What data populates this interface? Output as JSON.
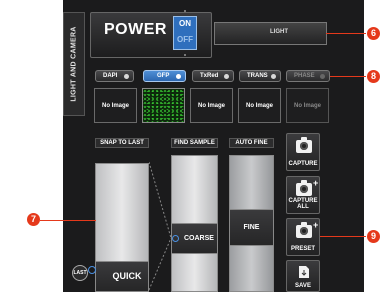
{
  "side_tab": "LIGHT AND CAMERA",
  "power": {
    "label": "POWER",
    "on": "ON",
    "off": "OFF"
  },
  "light": {
    "label": "LIGHT"
  },
  "channels": [
    {
      "label": "DAPI",
      "thumb": "No Image",
      "selected": false
    },
    {
      "label": "GFP",
      "thumb": "",
      "selected": true
    },
    {
      "label": "TxRed",
      "thumb": "No Image",
      "selected": false
    },
    {
      "label": "TRANS",
      "thumb": "No Image",
      "selected": false
    },
    {
      "label": "PHASE",
      "thumb": "No Image",
      "selected": false,
      "dimmed": true
    }
  ],
  "columns": {
    "snap_to_last": "SNAP TO LAST",
    "find_sample": "FIND SAMPLE",
    "auto_fine": "AUTO FINE"
  },
  "knobs": {
    "quick": "QUICK",
    "coarse": "COARSE",
    "fine": "FINE",
    "last": "LAST"
  },
  "tools": {
    "capture": "CAPTURE",
    "capture_all": "CAPTURE ALL",
    "preset": "PRESET",
    "save": "SAVE"
  },
  "callouts": {
    "top": "6",
    "channels": "8",
    "left": "7",
    "right": "9"
  },
  "colors": {
    "accent": "#2f6fbd",
    "callout": "#e5391b",
    "panel": "#1b1b1c"
  }
}
